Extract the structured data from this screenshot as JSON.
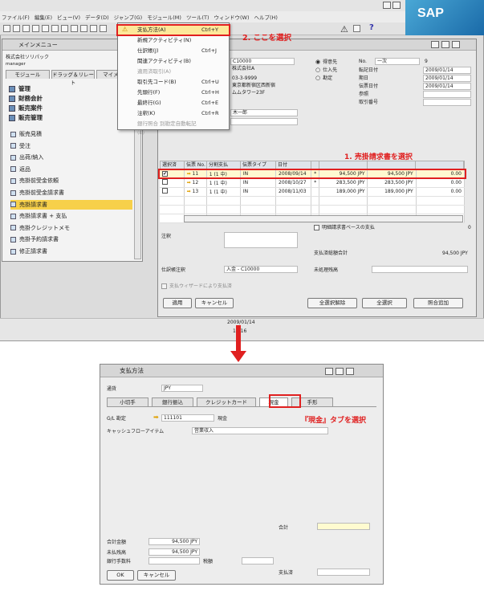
{
  "menubar": [
    "ファイル(F)",
    "編集(E)",
    "ビュー(V)",
    "データ(D)",
    "ジャンプ(G)",
    "モジュール(M)",
    "ツール(T)",
    "ウィンドウ(W)",
    "ヘルプ(H)"
  ],
  "sap_logo": "SAP",
  "callouts": {
    "step2": "2. ここを選択",
    "step1": "1. 売掛請求書を選択",
    "cash_tab": "『現金』タブを選択"
  },
  "main_menu": {
    "title": "メインメニュー",
    "company": "株式会社ソリパック",
    "user": "manager",
    "tabs": [
      "モジュール",
      "ドラッグ＆リレート",
      "マイメニュー"
    ],
    "groups": [
      "管理",
      "財務会計",
      "販売案件",
      "販売管理"
    ],
    "items": [
      "販売見積",
      "受注",
      "出荷/納入",
      "返品",
      "売掛前受金依頼",
      "売掛前受金請求書",
      "売掛請求書",
      "売掛請求書 + 支払",
      "売掛クレジットメモ",
      "売掛予約請求書",
      "修正請求書"
    ],
    "selected_item": "売掛請求書"
  },
  "dropdown": [
    {
      "label": "支払方法(A)",
      "shortcut": "Ctrl+Y",
      "state": "highlight"
    },
    {
      "label": "新規アクティビティ(N)",
      "shortcut": "",
      "state": "normal"
    },
    {
      "label": "仕訳帳(J)",
      "shortcut": "Ctrl+J",
      "state": "normal"
    },
    {
      "label": "関連アクティビティ(B)",
      "shortcut": "",
      "state": "normal"
    },
    {
      "label": "適用済取引(A)",
      "shortcut": "",
      "state": "disabled"
    },
    {
      "label": "取引先コード(B)",
      "shortcut": "Ctrl+U",
      "state": "normal"
    },
    {
      "label": "先頭行(F)",
      "shortcut": "Ctrl+H",
      "state": "normal"
    },
    {
      "label": "最終行(G)",
      "shortcut": "Ctrl+E",
      "state": "normal"
    },
    {
      "label": "注釈(K)",
      "shortcut": "Ctrl+R",
      "state": "normal"
    },
    {
      "label": "銀行照合 別勘定自動転記(E)",
      "shortcut": "",
      "state": "disabled"
    }
  ],
  "invoice": {
    "bp_code": "C10000",
    "bp_name": "株式会社A",
    "address1": "03-3-9999",
    "address2": "東京都新宿区西新宿",
    "address3": "ムムタワー23F",
    "contact": "木一郎",
    "radios": [
      "得意先",
      "仕入先",
      "勘定"
    ],
    "no_label": "No.",
    "no_series": "一次",
    "no_value": "9",
    "date_fields": [
      {
        "label": "転記日付",
        "value": "2009/01/14"
      },
      {
        "label": "期日",
        "value": "2009/01/14"
      },
      {
        "label": "伝票日付",
        "value": "2009/01/14"
      },
      {
        "label": "参照",
        "value": ""
      },
      {
        "label": "取引番号",
        "value": ""
      }
    ],
    "grid_headers": [
      "選択済",
      "伝票 No.",
      "分割支払",
      "伝票タイプ",
      "日付",
      "",
      "",
      "",
      ""
    ],
    "rows": [
      {
        "checked": "✔",
        "doc": "11",
        "split": "1 (1 中)",
        "type": "IN",
        "date": "2008/09/14",
        "mark": "*",
        "amt1": "94,500 JPY",
        "amt2": "94,500 JPY",
        "amt3": "0.00"
      },
      {
        "checked": "",
        "doc": "12",
        "split": "1 (1 中)",
        "type": "IN",
        "date": "2008/10/27",
        "mark": "*",
        "amt1": "283,500 JPY",
        "amt2": "283,500 JPY",
        "amt3": "0.00"
      },
      {
        "checked": "",
        "doc": "13",
        "split": "1 (1 中)",
        "type": "IN",
        "date": "2008/11/03",
        "mark": "",
        "amt1": "189,000 JPY",
        "amt2": "189,000 JPY",
        "amt3": "0.00"
      }
    ],
    "remarks_label": "注釈",
    "open_basis": "明細請求書ベースの支払",
    "open_value": "0",
    "total_label": "支払済総額合計",
    "total_value": "94,500 JPY",
    "journal_label": "仕訳帳注釈",
    "journal_value": "入金 - C10000",
    "pending_label": "未処理残高",
    "wizard": "支払ウィザードにより支払済",
    "buttons": [
      "適用",
      "キャンセル",
      "全選択解除",
      "全選択",
      "照合追加"
    ]
  },
  "status_date": "2009/01/14",
  "status_time": "15:16",
  "payment": {
    "title": "支払方法",
    "currency_label": "通貨",
    "currency_value": "JPY",
    "tabs": [
      "小切手",
      "銀行振込",
      "クレジットカード",
      "現金",
      "手形"
    ],
    "gl_label": "G/L 勘定",
    "gl_value": "111101",
    "gl_name": "現金",
    "cashflow_label": "キャッシュフローアイテム",
    "cashflow_value": "営業収入",
    "total_label": "合計",
    "sum_label": "合計金額",
    "sum_value": "94,500 JPY",
    "remaining_label": "未払残高",
    "remaining_value": "94,500 JPY",
    "bankfee_label": "銀行手数料",
    "tax_label": "税額",
    "paid_label": "支払済",
    "ok": "OK",
    "cancel": "キャンセル"
  }
}
